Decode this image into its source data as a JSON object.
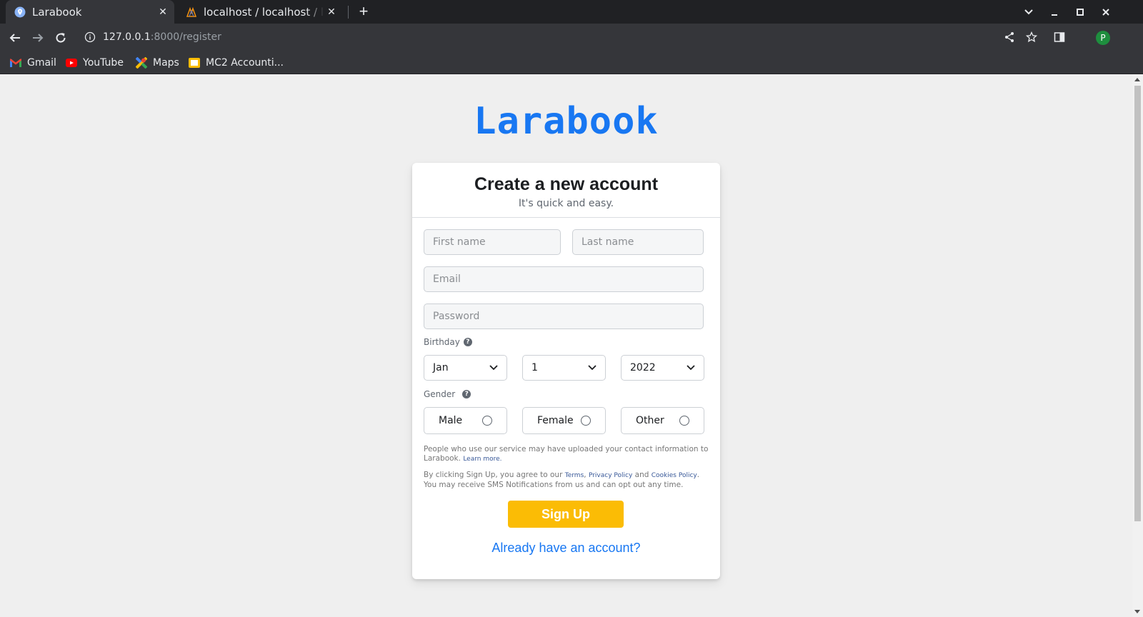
{
  "browser": {
    "tabs": [
      {
        "title": "Larabook",
        "active": true,
        "favicon": "globe-pin-icon"
      },
      {
        "title": "localhost / localhost / lara",
        "active": false,
        "favicon": "phpmyadmin-icon"
      }
    ],
    "url_host": "127.0.0.1",
    "url_path": ":8000/register",
    "profile_initial": "P",
    "bookmarks": [
      {
        "label": "Gmail",
        "icon": "gmail-icon"
      },
      {
        "label": "YouTube",
        "icon": "youtube-icon"
      },
      {
        "label": "Maps",
        "icon": "maps-icon"
      },
      {
        "label": "MC2 Accounti...",
        "icon": "folder-icon"
      }
    ]
  },
  "page": {
    "brand": "Larabook",
    "heading": "Create a new account",
    "subheading": "It's quick and easy.",
    "fields": {
      "first_name_placeholder": "First name",
      "last_name_placeholder": "Last name",
      "email_placeholder": "Email",
      "password_placeholder": "Password"
    },
    "birthday": {
      "label": "Birthday",
      "month": "Jan",
      "day": "1",
      "year": "2022"
    },
    "gender": {
      "label": "Gender",
      "options": [
        "Male",
        "Female",
        "Other"
      ]
    },
    "legal": {
      "contact_text": "People who use our service may have uploaded your contact information to Larabook.",
      "learn_more": "Learn more.",
      "terms_prefix": "By clicking Sign Up, you agree to our",
      "terms": "Terms",
      "privacy": "Privacy Policy",
      "and": "and",
      "cookies": "Cookies Policy",
      "terms_suffix": ". You may receive SMS Notifications from us and can opt out any time."
    },
    "signup_label": "Sign Up",
    "login_link": "Already have an account?"
  },
  "colors": {
    "brand": "#1877f2",
    "signup_button": "#fbbc05",
    "page_bg": "#efefef"
  }
}
